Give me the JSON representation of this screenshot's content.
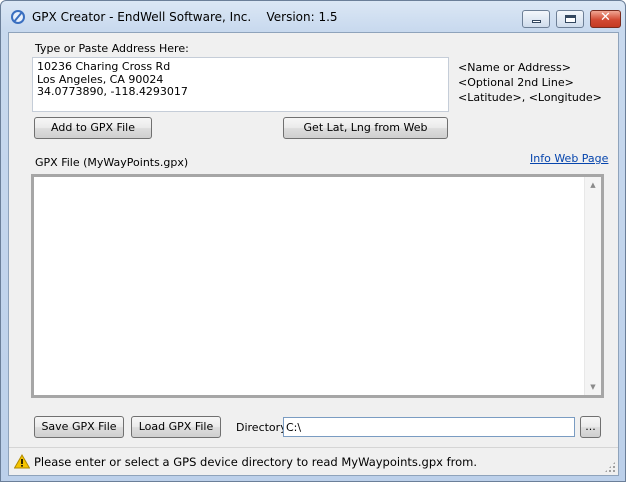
{
  "window": {
    "title": "GPX Creator - EndWell Software, Inc.    Version: 1.5",
    "minimize_icon": "minimize-icon",
    "maximize_icon": "maximize-icon",
    "close_icon": "close-icon",
    "close_glyph": "✕"
  },
  "address": {
    "label": "Type or Paste Address Here:",
    "lines": [
      "10236 Charing Cross Rd",
      "Los Angeles, CA 90024",
      "34.0773890, -118.4293017"
    ],
    "hints": [
      "<Name or Address>",
      "<Optional 2nd Line>",
      "<Latitude>, <Longitude>"
    ]
  },
  "buttons": {
    "add_to_gpx": "Add to GPX File",
    "get_lat_lng": "Get Lat, Lng from Web",
    "save_gpx": "Save GPX File",
    "load_gpx": "Load GPX File",
    "browse": "..."
  },
  "gpx": {
    "label": "GPX File (MyWayPoints.gpx)",
    "info_link": "Info Web Page",
    "content": ""
  },
  "directory": {
    "label": "Directory:",
    "value": "C:\\"
  },
  "status": {
    "icon": "warning-icon",
    "text": "Please enter or select a GPS device directory to read MyWaypoints.gpx from."
  },
  "colors": {
    "titlebar": "#c8d9ee",
    "client_bg": "#f0f0f0",
    "link": "#0645ad",
    "close_button": "#c43a22",
    "warning": "#f5c400"
  }
}
